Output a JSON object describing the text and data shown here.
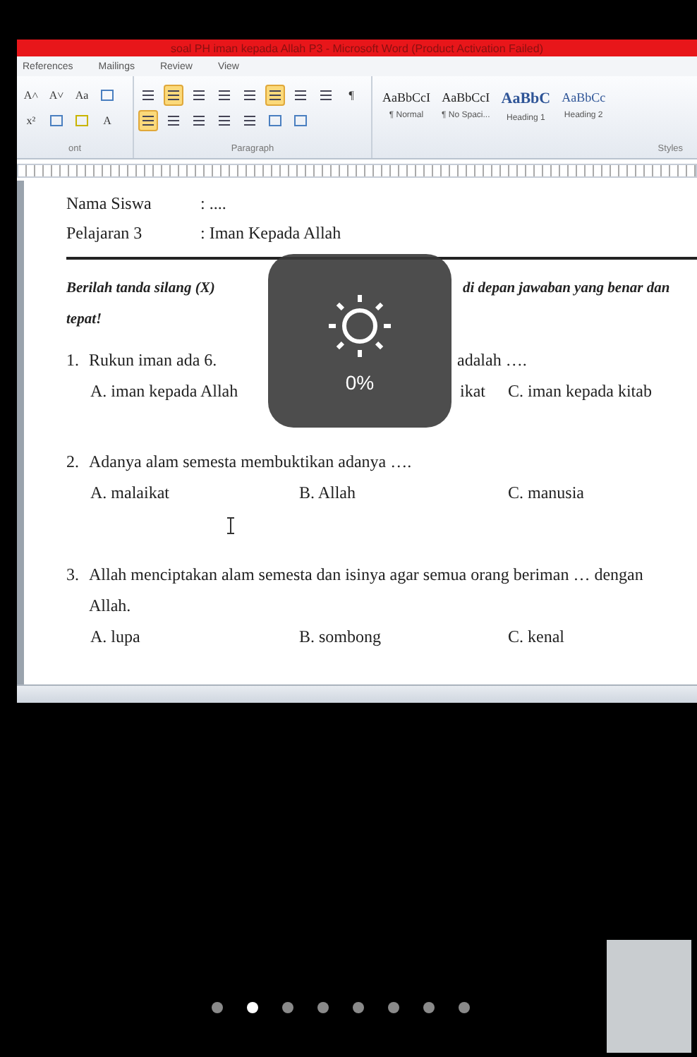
{
  "window": {
    "title": "soal PH iman kepada Allah P3  -  Microsoft Word (Product Activation Failed)"
  },
  "ribbon_tabs": [
    "References",
    "Mailings",
    "Review",
    "View"
  ],
  "toolbar": {
    "row_1": [
      {
        "kind": "grow",
        "label": "A˄",
        "active": false
      },
      {
        "kind": "shrink",
        "label": "A˅",
        "active": false
      },
      {
        "kind": "case",
        "label": "Aa",
        "active": false
      },
      {
        "kind": "clear",
        "active": false
      },
      {
        "kind": "bullets",
        "active": false
      },
      {
        "kind": "numbering",
        "active": true
      },
      {
        "kind": "multilevel",
        "active": false
      },
      {
        "kind": "outdent",
        "active": false
      },
      {
        "kind": "indent",
        "active": false
      },
      {
        "kind": "ltr",
        "active": true
      },
      {
        "kind": "rtl",
        "active": false
      },
      {
        "kind": "sort",
        "active": false
      },
      {
        "kind": "pilcrow",
        "label": "¶",
        "active": false
      }
    ],
    "row_2": [
      {
        "kind": "superscript",
        "label": "x²",
        "active": false
      },
      {
        "kind": "effects",
        "active": false
      },
      {
        "kind": "highlight",
        "active": false
      },
      {
        "kind": "fontcolor",
        "label": "A",
        "active": false
      },
      {
        "kind": "alignleft",
        "active": true
      },
      {
        "kind": "center",
        "active": false
      },
      {
        "kind": "alignright",
        "active": false
      },
      {
        "kind": "justify",
        "active": false
      },
      {
        "kind": "spacing",
        "active": false
      },
      {
        "kind": "shading",
        "active": false
      },
      {
        "kind": "borders",
        "active": false
      }
    ]
  },
  "styles": [
    {
      "preview": "AaBbCcI",
      "name": "¶ Normal",
      "kind": "body"
    },
    {
      "preview": "AaBbCcI",
      "name": "¶ No Spaci...",
      "kind": "body"
    },
    {
      "preview": "AaBbC",
      "name": "Heading 1",
      "kind": "heading"
    },
    {
      "preview": "AaBbCc",
      "name": "Heading 2",
      "kind": "subheading"
    }
  ],
  "group_labels": [
    "ont",
    "Paragraph",
    "Styles"
  ],
  "document": {
    "fields": [
      {
        "label": "Nama Siswa",
        "value": ": ...."
      },
      {
        "label": "Pelajaran 3",
        "value": ": Iman Kepada Allah"
      }
    ],
    "instruction": {
      "before_popup": "Berilah tanda silang (X)",
      "after_popup": "di depan jawaban yang benar dan",
      "line_2": "tepat!"
    },
    "questions": [
      {
        "number": "1.",
        "text": "Rukun iman ada 6.",
        "text_after_popup": "adalah ….",
        "options": [
          {
            "text": "A. iman kepada Allah",
            "kind": "full"
          },
          {
            "text": "ikat",
            "kind": "cut"
          },
          {
            "text": "C. iman kepada kitab",
            "kind": "full"
          }
        ]
      },
      {
        "number": "2.",
        "text": "Adanya alam semesta membuktikan adanya ….",
        "options": [
          {
            "text": "A. malaikat",
            "kind": "full"
          },
          {
            "text": "B. Allah",
            "kind": "full"
          },
          {
            "text": "C. manusia",
            "kind": "full"
          }
        ]
      },
      {
        "number": "3.",
        "text": "Allah menciptakan alam semesta dan isinya agar semua orang beriman … dengan Allah.",
        "options": [
          {
            "text": "A. lupa",
            "kind": "full"
          },
          {
            "text": "B. sombong",
            "kind": "full"
          },
          {
            "text": "C. kenal",
            "kind": "full"
          }
        ]
      }
    ]
  },
  "brightness": {
    "reading": "0%"
  },
  "pages": [
    {
      "selected": false
    },
    {
      "selected": true
    },
    {
      "selected": false
    },
    {
      "selected": false
    },
    {
      "selected": false
    },
    {
      "selected": false
    },
    {
      "selected": false
    },
    {
      "selected": false
    }
  ]
}
